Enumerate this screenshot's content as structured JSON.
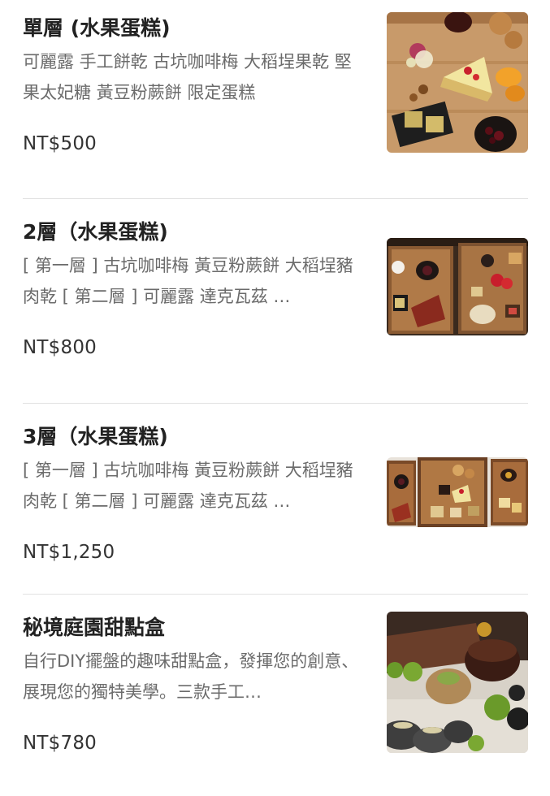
{
  "menu": {
    "items": [
      {
        "name": "單層 (水果蛋糕)",
        "description": "可麗露 手工餅乾 古坑咖啡梅 大稻埕果乾 堅果太妃糖 黃豆粉蕨餅 限定蛋糕",
        "price": "NT$500",
        "image": "dessert-platter-photo"
      },
      {
        "name": "2層（水果蛋糕)",
        "description": "[ 第一層 ] 古坑咖啡梅 黃豆粉蕨餅 大稻埕豬肉乾 [ 第二層 ] 可麗露 達克瓦茲 …",
        "price": "NT$800",
        "image": "two-tier-wooden-tray-photo"
      },
      {
        "name": "3層（水果蛋糕)",
        "description": "[ 第一層 ] 古坑咖啡梅 黃豆粉蕨餅 大稻埕豬肉乾 [ 第二層 ] 可麗露 達克瓦茲 …",
        "price": "NT$1,250",
        "image": "three-tier-wooden-tray-photo"
      },
      {
        "name": "秘境庭園甜點盒",
        "description": "自行DIY擺盤的趣味甜點盒，發揮您的創意、展現您的獨特美學。三款手工…",
        "price": "NT$780",
        "image": "garden-dessert-box-photo"
      }
    ]
  },
  "colors": {
    "title": "#222222",
    "description": "#6b6b6b",
    "price": "#333333",
    "divider": "#e2e2e2"
  }
}
